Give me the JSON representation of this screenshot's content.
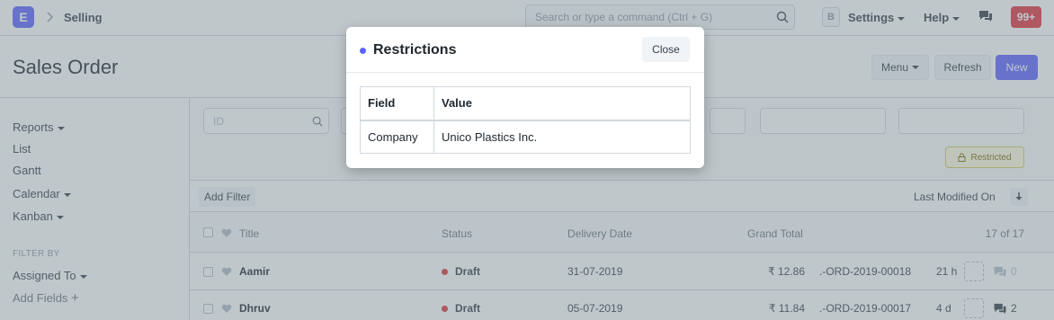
{
  "navbar": {
    "logo_letter": "E",
    "breadcrumb": "Selling",
    "search_placeholder": "Search or type a command (Ctrl + G)",
    "user_initial": "B",
    "settings_label": "Settings",
    "help_label": "Help",
    "notifications_badge": "99+"
  },
  "page": {
    "title": "Sales Order",
    "menu_label": "Menu",
    "refresh_label": "Refresh",
    "new_label": "New"
  },
  "sidebar": {
    "items": [
      "Reports",
      "List",
      "Gantt",
      "Calendar",
      "Kanban"
    ],
    "filter_heading": "FILTER BY",
    "assigned_to": "Assigned To",
    "add_fields": "Add Fields"
  },
  "filters": {
    "id_placeholder": "ID",
    "restricted_label": "Restricted"
  },
  "filter_bar": {
    "add_filter_label": "Add Filter",
    "sort_label": "Last Modified On"
  },
  "list": {
    "columns": {
      "title": "Title",
      "status": "Status",
      "delivery_date": "Delivery Date",
      "grand_total": "Grand Total",
      "count": "17 of 17"
    },
    "rows": [
      {
        "title": "Aamir",
        "status": "Draft",
        "delivery_date": "31-07-2019",
        "grand_total": "₹ 12.86",
        "name": ".-ORD-2019-00018",
        "modified": "21 h",
        "comments": "0"
      },
      {
        "title": "Dhruv",
        "status": "Draft",
        "delivery_date": "05-07-2019",
        "grand_total": "₹ 11.84",
        "name": ".-ORD-2019-00017",
        "modified": "4 d",
        "comments": "2"
      }
    ]
  },
  "modal": {
    "title": "Restrictions",
    "close_label": "Close",
    "headers": {
      "field": "Field",
      "value": "Value"
    },
    "rows": [
      {
        "field": "Company",
        "value": "Unico Plastics Inc."
      }
    ]
  },
  "colors": {
    "primary": "#5e64ff",
    "danger": "#e0353e",
    "border": "#d1d8dd"
  }
}
